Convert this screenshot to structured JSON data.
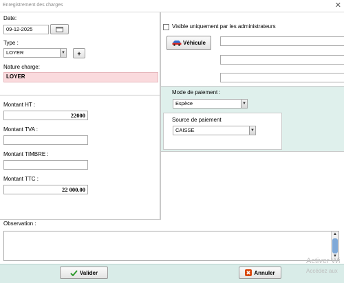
{
  "window": {
    "title": "Enregistrement des charges",
    "close_glyph": "✕"
  },
  "left": {
    "date_label": "Date:",
    "date_value": "09-12-2025",
    "type_label": "Type :",
    "type_value": "LOYER",
    "add_glyph": "+",
    "nature_label": "Nature charge:",
    "nature_value": "LOYER",
    "montant_ht_label": "Montant HT :",
    "montant_ht_value": "22000",
    "montant_tva_label": "Montant TVA :",
    "montant_tva_value": "",
    "montant_timbre_label": "Montant TIMBRE :",
    "montant_timbre_value": "",
    "montant_ttc_label": "Montant TTC :",
    "montant_ttc_value": "22 000.00"
  },
  "right": {
    "visible_admin_label": "Visible uniquement par les administrateurs",
    "visible_admin_checked": false,
    "vehicule_button": "Véhicule",
    "vehicule_fields": [
      "",
      "",
      ""
    ],
    "mode_paiement_label": "Mode de paiement :",
    "mode_paiement_value": "Espèce",
    "source_paiement_label": "Source de paiement",
    "source_paiement_value": "CAISSE"
  },
  "observation": {
    "label": "Observation :",
    "value": ""
  },
  "actions": {
    "valider": "Valider",
    "annuler": "Annuler"
  },
  "watermark": {
    "line1": "Activer Wi",
    "line2": "Accédez aux"
  },
  "colors": {
    "pink_field": "#fadadd",
    "panel_teal": "#dff0ec",
    "bottom_bar": "#d9ece8",
    "valider_icon": "#2e9a2e",
    "annuler_icon": "#d9480f",
    "vehicule_icon": "#2f6fd1"
  }
}
